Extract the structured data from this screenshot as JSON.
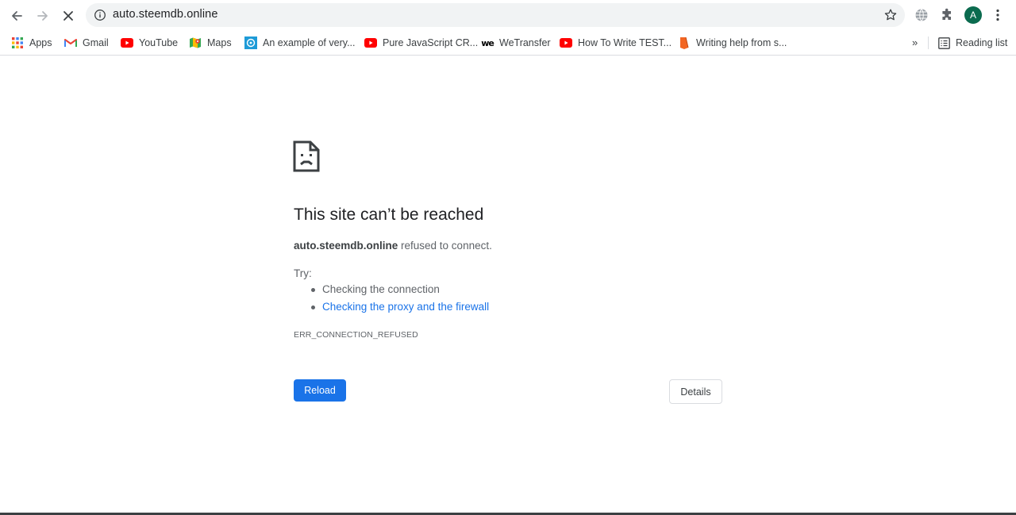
{
  "browser": {
    "url": "auto.steemdb.online",
    "avatar_letter": "A",
    "accent": "#1a73e8",
    "avatar_color": "#0b6b4f"
  },
  "bookmarks": {
    "items": [
      {
        "label": "Apps",
        "icon": "apps-grid-icon"
      },
      {
        "label": "Gmail",
        "icon": "gmail-icon"
      },
      {
        "label": "YouTube",
        "icon": "youtube-icon"
      },
      {
        "label": "Maps",
        "icon": "maps-icon"
      },
      {
        "label": "An example of very...",
        "icon": "site-icon"
      },
      {
        "label": "Pure JavaScript CR...",
        "icon": "youtube-icon"
      },
      {
        "label": "WeTransfer",
        "icon": "wetransfer-icon"
      },
      {
        "label": "How To Write TEST...",
        "icon": "youtube-icon"
      },
      {
        "label": "Writing help from s...",
        "icon": "pen-icon"
      }
    ],
    "overflow": "»",
    "reading_list": "Reading list"
  },
  "error": {
    "title": "This site can’t be reached",
    "host": "auto.steemdb.online",
    "desc_suffix": " refused to connect.",
    "try_label": "Try:",
    "suggestions": [
      "Checking the connection",
      "Checking the proxy and the firewall"
    ],
    "code": "ERR_CONNECTION_REFUSED",
    "reload_label": "Reload",
    "details_label": "Details"
  }
}
